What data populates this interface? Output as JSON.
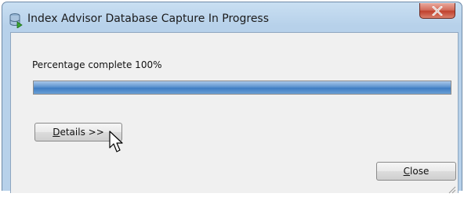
{
  "window": {
    "title": "Index Advisor Database Capture In Progress",
    "title_icon": "database-capture-icon",
    "close_icon": "close-icon"
  },
  "progress": {
    "label": "Percentage complete 100%",
    "percent": 100
  },
  "buttons": {
    "details_mnemonic": "D",
    "details_rest": "etails >>",
    "close_mnemonic": "C",
    "close_rest": "lose"
  },
  "colors": {
    "titlebar": "#b7d1ea",
    "client": "#f0f0f0",
    "progress_fill": "#4f89c9",
    "close_button": "#c1422f"
  },
  "cursor_icon": "arrow-cursor-icon"
}
